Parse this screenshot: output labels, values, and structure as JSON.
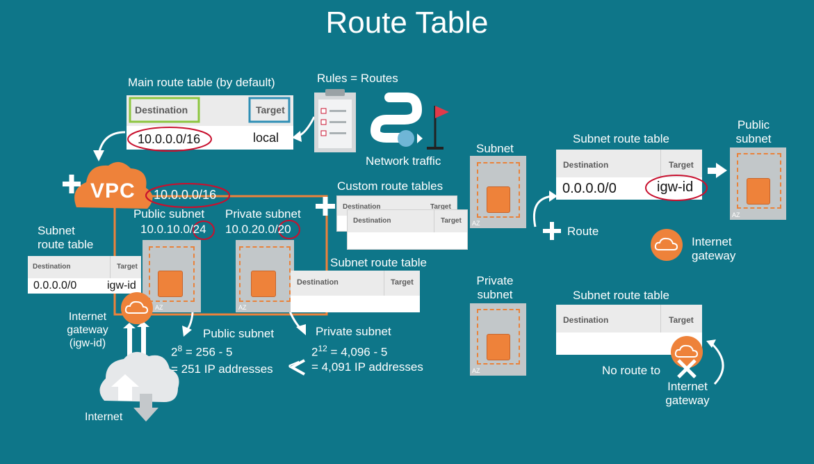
{
  "title": "Route Table",
  "rules_routes": "Rules  =  Routes",
  "network_traffic": "Network traffic",
  "main_table": {
    "caption": "Main route table (by default)",
    "dest_header": "Destination",
    "target_header": "Target",
    "destination": "10.0.0.0/16",
    "target": "local"
  },
  "vpc": {
    "label": "VPC",
    "cidr": "10.0.0.0/16",
    "public_subnet_title": "Public subnet",
    "public_cidr_prefix": "10.0.10.0/",
    "public_mask": "24",
    "private_subnet_title": "Private subnet",
    "private_cidr_prefix": "10.0.20.0/",
    "private_mask": "20"
  },
  "left_table": {
    "caption": "Subnet\nroute table",
    "dest_header": "Destination",
    "target_header": "Target",
    "destination": "0.0.0.0/0",
    "target": "igw-id"
  },
  "left_igw": "Internet\ngateway\n(igw-id)",
  "internet": "Internet",
  "custom_tables": {
    "caption": "Custom route tables",
    "dest_header": "Destination",
    "target_header": "Target"
  },
  "private_route_table": {
    "caption": "Subnet route table",
    "dest_header": "Destination",
    "target_header": "Target"
  },
  "public_calc": {
    "title": "Public subnet",
    "base": "2",
    "exp": "8",
    "line1": " = 256 - 5",
    "line2": "= 251 IP addresses"
  },
  "private_calc": {
    "title": "Private subnet",
    "base": "2",
    "exp": "12",
    "line1": " = 4,096 - 5",
    "line2": "= 4,091 IP addresses"
  },
  "compare": "<",
  "right_subnet": "Subnet",
  "right_table": {
    "caption": "Subnet route table",
    "dest_header": "Destination",
    "target_header": "Target",
    "destination": "0.0.0.0/0",
    "target": "igw-id"
  },
  "public_subnet_right": "Public\nsubnet",
  "route_label": "Route",
  "right_igw": "Internet\ngateway",
  "private_subnet_right": "Private\nsubnet",
  "bottom_table": {
    "caption": "Subnet route table",
    "dest_header": "Destination",
    "target_header": "Target"
  },
  "no_route": "No route to",
  "bottom_igw": "Internet\ngateway",
  "az": "AZ",
  "colors": {
    "background": "#0e7689",
    "orange": "#ee823a",
    "highlight_red": "#c8102e",
    "green": "#8cc63f",
    "blue": "#2f8fb5"
  }
}
